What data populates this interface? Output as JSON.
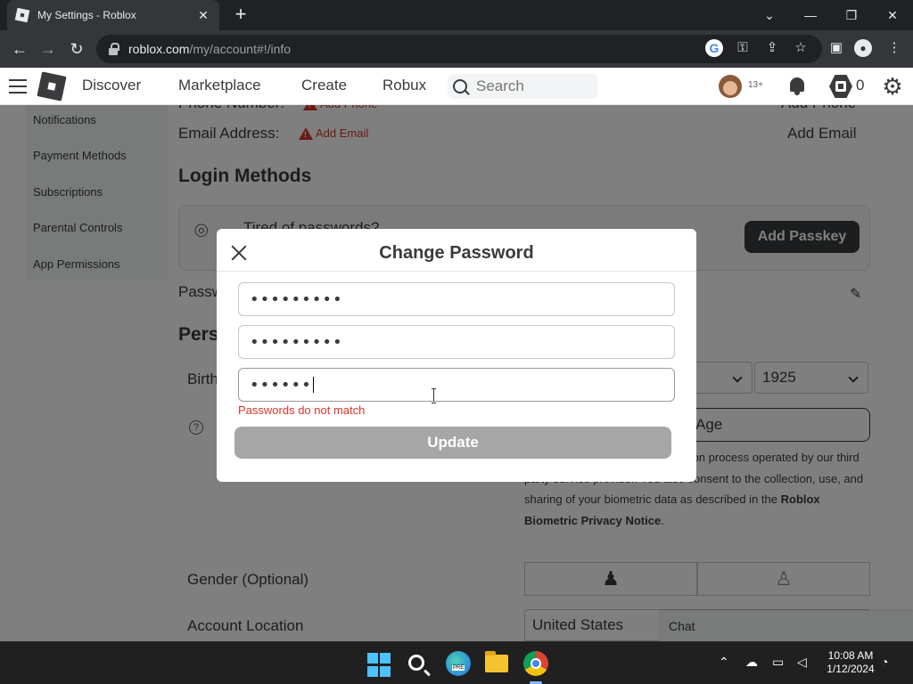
{
  "browser": {
    "tab_title": "My Settings - Roblox",
    "tab_close": "✕",
    "new_tab": "+",
    "window_controls": {
      "chevron": "⌄",
      "minimize": "—",
      "maximize": "❐",
      "close": "✕"
    },
    "url_host": "roblox.com",
    "url_path": "/my/account#!/info",
    "back_icon": "arrow-left-icon",
    "forward_icon": "arrow-right-icon",
    "reload_icon": "reload-icon"
  },
  "header": {
    "nav": [
      "Discover",
      "Marketplace",
      "Create",
      "Robux"
    ],
    "search_placeholder": "Search",
    "age_badge": "13+",
    "robux_count": "0"
  },
  "sidebar": {
    "items": [
      "Notifications",
      "Payment Methods",
      "Subscriptions",
      "Parental Controls",
      "App Permissions"
    ]
  },
  "account": {
    "phone_label": "Phone Number:",
    "add_phone_link": "Add Phone",
    "add_phone_right": "Add Phone",
    "email_label": "Email Address:",
    "add_email_link": "Add Email",
    "add_email_right": "Add Email",
    "login_methods_heading": "Login Methods",
    "passkey_prompt": "Tired of passwords?",
    "add_passkey_button": "Add Passkey",
    "password_label_partial": "Passw",
    "personal_heading_partial": "Pers",
    "birthday_label_partial": "Birth",
    "birth_year": "1925",
    "verify_age_partial": "My Age",
    "consent_text_prefix": "will be completing an ID verification process operated by our third party service provider. You also consent to the collection, use, and sharing of your biometric data as described in the ",
    "consent_link": "Roblox Biometric Privacy Notice",
    "consent_suffix": ".",
    "gender_label": "Gender (Optional)",
    "account_location_label": "Account Location",
    "account_location_value": "United States",
    "chat_label": "Chat"
  },
  "modal": {
    "title": "Change Password",
    "current_password": "•••••••••",
    "new_password": "•••••••••",
    "confirm_password": "••••••",
    "error": "Passwords do not match",
    "update_button": "Update"
  },
  "taskbar": {
    "time": "10:08 AM",
    "date": "1/12/2024",
    "edge_badge": "PRE"
  }
}
